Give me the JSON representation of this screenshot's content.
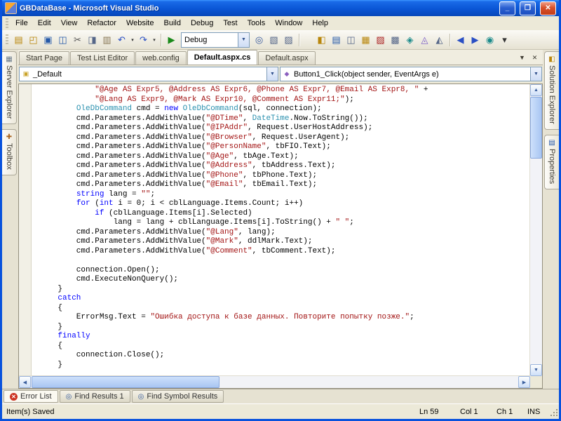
{
  "window": {
    "title": "GBDataBase - Microsoft Visual Studio"
  },
  "menu": {
    "items": [
      "File",
      "Edit",
      "View",
      "Refactor",
      "Website",
      "Build",
      "Debug",
      "Test",
      "Tools",
      "Window",
      "Help"
    ]
  },
  "toolbar": {
    "debug_config": "Debug",
    "group_file": [
      {
        "name": "add-new-item",
        "glyph": "▤",
        "color": "#b8860b"
      },
      {
        "name": "open-file",
        "glyph": "◰",
        "color": "#b8860b"
      },
      {
        "name": "save",
        "glyph": "▣",
        "color": "#2458a8"
      },
      {
        "name": "save-all",
        "glyph": "◫",
        "color": "#2458a8"
      },
      {
        "name": "cut",
        "glyph": "✂",
        "color": "#555555"
      },
      {
        "name": "copy",
        "glyph": "◨",
        "color": "#556688"
      },
      {
        "name": "paste",
        "glyph": "▥",
        "color": "#887755"
      },
      {
        "name": "undo",
        "glyph": "↶",
        "color": "#2a4fc4",
        "caret": true
      },
      {
        "name": "redo",
        "glyph": "↷",
        "color": "#2a4fc4",
        "caret": true
      }
    ],
    "group_debug": [
      {
        "name": "start-debug",
        "glyph": "▶",
        "color": "#1a8a1a"
      }
    ],
    "group_find": [
      {
        "name": "find-in-files",
        "glyph": "◎",
        "color": "#335599"
      },
      {
        "name": "command-window",
        "glyph": "▧",
        "color": "#556688"
      },
      {
        "name": "immediate-window",
        "glyph": "▨",
        "color": "#556688"
      }
    ],
    "group_views": [
      {
        "name": "solution-explorer",
        "glyph": "◧",
        "color": "#b8860b"
      },
      {
        "name": "properties-window",
        "glyph": "▤",
        "color": "#2458a8"
      },
      {
        "name": "object-browser",
        "glyph": "◫",
        "color": "#556688"
      },
      {
        "name": "toolbox",
        "glyph": "▦",
        "color": "#b8860b"
      },
      {
        "name": "error-list",
        "glyph": "▨",
        "color": "#aa2222"
      },
      {
        "name": "output-window",
        "glyph": "▩",
        "color": "#556688"
      },
      {
        "name": "start-page",
        "glyph": "◈",
        "color": "#1a8a8a"
      },
      {
        "name": "class-view",
        "glyph": "◬",
        "color": "#7a5dc7"
      },
      {
        "name": "document-outline",
        "glyph": "◭",
        "color": "#556688"
      }
    ],
    "group_extra": [
      {
        "name": "navigate-backward",
        "glyph": "◀",
        "color": "#2a4fc4"
      },
      {
        "name": "navigate-forward",
        "glyph": "▶",
        "color": "#2a4fc4"
      },
      {
        "name": "web-browser",
        "glyph": "◉",
        "color": "#1a8a8a"
      },
      {
        "name": "toolbar-overflow",
        "glyph": "▾",
        "color": "#333333"
      }
    ]
  },
  "doc_tabs": [
    {
      "label": "Start Page",
      "active": false
    },
    {
      "label": "Test List Editor",
      "active": false
    },
    {
      "label": "web.config",
      "active": false
    },
    {
      "label": "Default.aspx.cs",
      "active": true
    },
    {
      "label": "Default.aspx",
      "active": false
    }
  ],
  "doc_controls": {
    "dropdown_glyph": "▼",
    "close_glyph": "✕"
  },
  "navigation": {
    "class_dropdown": "_Default",
    "class_icon_glyph": "▣",
    "class_icon_color": "#c9a227",
    "method_dropdown": "Button1_Click(object sender, EventArgs e)",
    "method_icon_glyph": "◆",
    "method_icon_color": "#8b5fbf"
  },
  "left_panel": {
    "tabs": [
      {
        "label": "Server Explorer",
        "glyph": "▦",
        "color": "#667788"
      },
      {
        "label": "Toolbox",
        "glyph": "✚",
        "color": "#aa6622"
      }
    ]
  },
  "right_panel": {
    "tabs": [
      {
        "label": "Solution Explorer",
        "glyph": "◧",
        "color": "#b8860b"
      },
      {
        "label": "Properties",
        "glyph": "▤",
        "color": "#2458a8"
      }
    ]
  },
  "bottom_tabs": [
    {
      "label": "Error List",
      "icon": "error",
      "active": true
    },
    {
      "label": "Find Results 1",
      "icon": "find",
      "active": false
    },
    {
      "label": "Find Symbol Results",
      "icon": "find",
      "active": false
    }
  ],
  "status_bar": {
    "message": "Item(s) Saved",
    "line": "Ln 59",
    "col": "Col 1",
    "ch": "Ch 1",
    "mode": "INS"
  },
  "colors": {
    "keyword": "#0000ff",
    "string": "#a31515",
    "type": "#2b91af",
    "titlebar": "#0a55d5"
  },
  "editor": {
    "lines": [
      [
        [
          "p",
          "            "
        ],
        [
          "s",
          "\"@Age AS Expr5, @Address AS Expr6, @Phone AS Expr7, @Email AS Expr8, \""
        ],
        [
          "p",
          " +"
        ]
      ],
      [
        [
          "p",
          "            "
        ],
        [
          "s",
          "\"@Lang AS Expr9, @Mark AS Expr10, @Comment AS Expr11;\""
        ],
        [
          "p",
          ");"
        ]
      ],
      [
        [
          "p",
          "        "
        ],
        [
          "t",
          "OleDbCommand"
        ],
        [
          "p",
          " cmd = "
        ],
        [
          "k",
          "new"
        ],
        [
          "p",
          " "
        ],
        [
          "t",
          "OleDbCommand"
        ],
        [
          "p",
          "(sql, connection);"
        ]
      ],
      [
        [
          "p",
          "        cmd.Parameters.AddWithValue("
        ],
        [
          "s",
          "\"@DTime\""
        ],
        [
          "p",
          ", "
        ],
        [
          "t",
          "DateTime"
        ],
        [
          "p",
          ".Now.ToString());"
        ]
      ],
      [
        [
          "p",
          "        cmd.Parameters.AddWithValue("
        ],
        [
          "s",
          "\"@IPAddr\""
        ],
        [
          "p",
          ", Request.UserHostAddress);"
        ]
      ],
      [
        [
          "p",
          "        cmd.Parameters.AddWithValue("
        ],
        [
          "s",
          "\"@Browser\""
        ],
        [
          "p",
          ", Request.UserAgent);"
        ]
      ],
      [
        [
          "p",
          "        cmd.Parameters.AddWithValue("
        ],
        [
          "s",
          "\"@PersonName\""
        ],
        [
          "p",
          ", tbFIO.Text);"
        ]
      ],
      [
        [
          "p",
          "        cmd.Parameters.AddWithValue("
        ],
        [
          "s",
          "\"@Age\""
        ],
        [
          "p",
          ", tbAge.Text);"
        ]
      ],
      [
        [
          "p",
          "        cmd.Parameters.AddWithValue("
        ],
        [
          "s",
          "\"@Address\""
        ],
        [
          "p",
          ", tbAddress.Text);"
        ]
      ],
      [
        [
          "p",
          "        cmd.Parameters.AddWithValue("
        ],
        [
          "s",
          "\"@Phone\""
        ],
        [
          "p",
          ", tbPhone.Text);"
        ]
      ],
      [
        [
          "p",
          "        cmd.Parameters.AddWithValue("
        ],
        [
          "s",
          "\"@Email\""
        ],
        [
          "p",
          ", tbEmail.Text);"
        ]
      ],
      [
        [
          "p",
          "        "
        ],
        [
          "k",
          "string"
        ],
        [
          "p",
          " lang = "
        ],
        [
          "s",
          "\"\""
        ],
        [
          "p",
          ";"
        ]
      ],
      [
        [
          "p",
          "        "
        ],
        [
          "k",
          "for"
        ],
        [
          "p",
          " ("
        ],
        [
          "k",
          "int"
        ],
        [
          "p",
          " i = 0; i < cblLanguage.Items.Count; i++)"
        ]
      ],
      [
        [
          "p",
          "            "
        ],
        [
          "k",
          "if"
        ],
        [
          "p",
          " (cblLanguage.Items[i].Selected)"
        ]
      ],
      [
        [
          "p",
          "                lang = lang + cblLanguage.Items[i].ToString() + "
        ],
        [
          "s",
          "\" \""
        ],
        [
          "p",
          ";"
        ]
      ],
      [
        [
          "p",
          "        cmd.Parameters.AddWithValue("
        ],
        [
          "s",
          "\"@Lang\""
        ],
        [
          "p",
          ", lang);"
        ]
      ],
      [
        [
          "p",
          "        cmd.Parameters.AddWithValue("
        ],
        [
          "s",
          "\"@Mark\""
        ],
        [
          "p",
          ", ddlMark.Text);"
        ]
      ],
      [
        [
          "p",
          "        cmd.Parameters.AddWithValue("
        ],
        [
          "s",
          "\"@Comment\""
        ],
        [
          "p",
          ", tbComment.Text);"
        ]
      ],
      [],
      [
        [
          "p",
          "        connection.Open();"
        ]
      ],
      [
        [
          "p",
          "        cmd.ExecuteNonQuery();"
        ]
      ],
      [
        [
          "p",
          "    }"
        ]
      ],
      [
        [
          "p",
          "    "
        ],
        [
          "k",
          "catch"
        ]
      ],
      [
        [
          "p",
          "    {"
        ]
      ],
      [
        [
          "p",
          "        ErrorMsg.Text = "
        ],
        [
          "s",
          "\"Ошибка доступа к базе данных. Повторите попытку позже.\""
        ],
        [
          "p",
          ";"
        ]
      ],
      [
        [
          "p",
          "    }"
        ]
      ],
      [
        [
          "p",
          "    "
        ],
        [
          "k",
          "finally"
        ]
      ],
      [
        [
          "p",
          "    {"
        ]
      ],
      [
        [
          "p",
          "        connection.Close();"
        ]
      ],
      [
        [
          "p",
          "    }"
        ]
      ],
      [],
      [
        [
          "p",
          "}"
        ]
      ]
    ]
  }
}
